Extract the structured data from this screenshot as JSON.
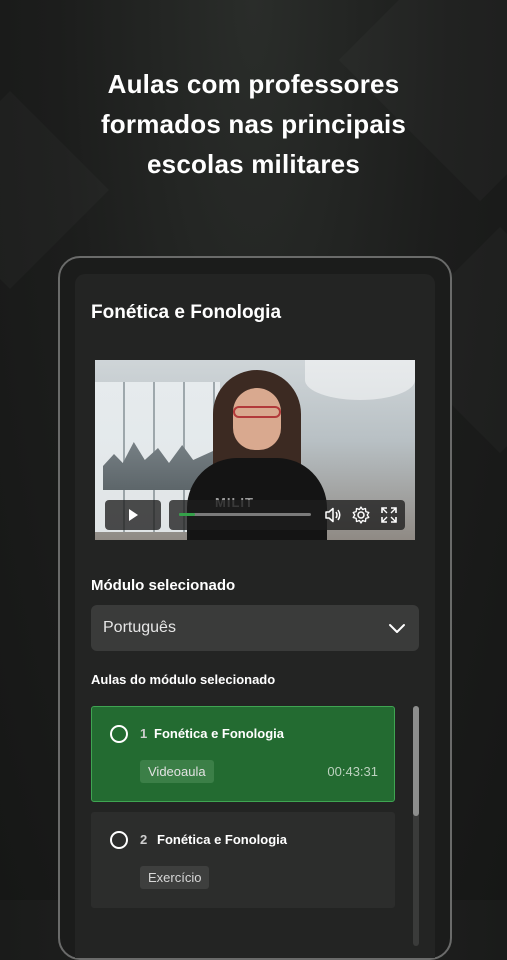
{
  "headline": {
    "line1": "Aulas com professores",
    "line2": "formados nas principais",
    "line3": "escolas militares"
  },
  "lesson": {
    "title": "Fonética e Fonologia",
    "video": {
      "progress_fraction": 0.12,
      "overlay_text": "MILIT",
      "icons": [
        "play-icon",
        "volume-icon",
        "settings-icon",
        "fullscreen-icon"
      ]
    }
  },
  "module": {
    "label": "Módulo selecionado",
    "selected": "Português"
  },
  "lessons_list": {
    "label": "Aulas do módulo selecionado",
    "items": [
      {
        "number": "1",
        "title": "Fonética e Fonologia",
        "type": "Videoaula",
        "duration": "00:43:31"
      },
      {
        "number": "2",
        "title": "Fonética e Fonologia",
        "type": "Exercício",
        "duration": ""
      }
    ]
  },
  "colors": {
    "accent": "#236b31",
    "accent_border": "#3fa552",
    "progress": "#35a14a"
  }
}
